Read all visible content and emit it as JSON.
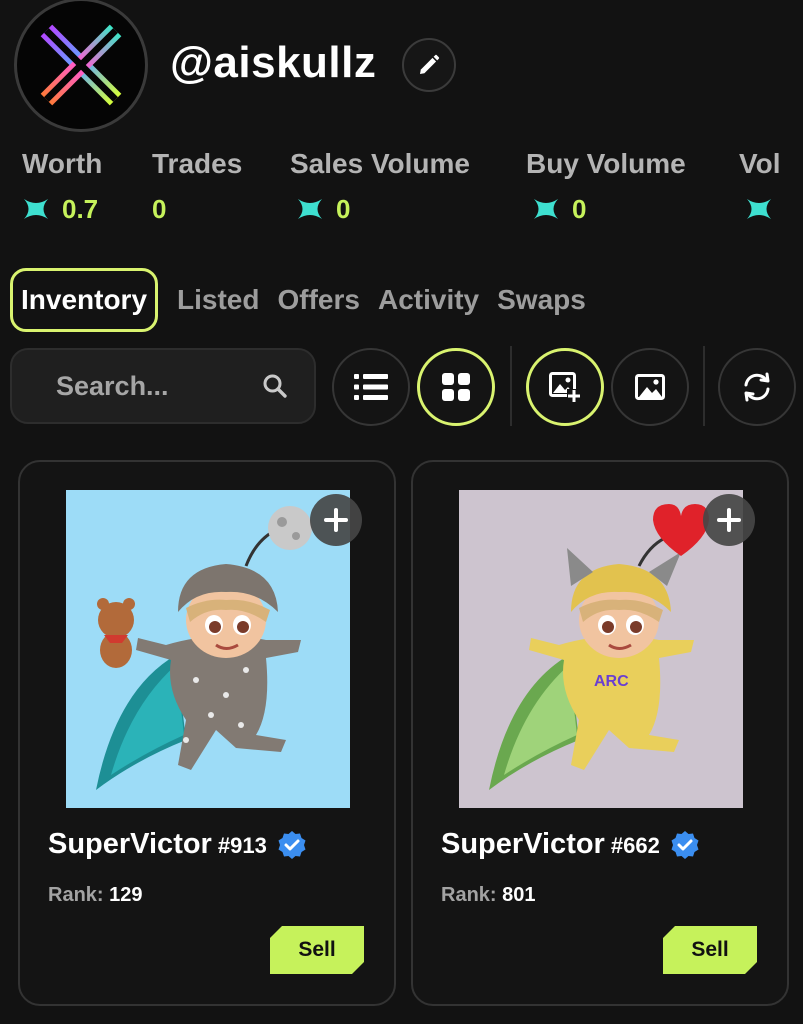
{
  "profile": {
    "username": "@aiskullz",
    "avatar_icon": "x-logo-icon",
    "edit_icon": "pencil-icon"
  },
  "stats": [
    {
      "label": "Worth",
      "value": "0.7",
      "currency_icon": "x-token-icon"
    },
    {
      "label": "Trades",
      "value": "0"
    },
    {
      "label": "Sales Volume",
      "value": "0",
      "currency_icon": "x-token-icon"
    },
    {
      "label": "Buy Volume",
      "value": "0",
      "currency_icon": "x-token-icon"
    },
    {
      "label": "Vol",
      "value": "",
      "currency_icon": "x-token-icon"
    }
  ],
  "tabs": [
    {
      "label": "Inventory",
      "active": true
    },
    {
      "label": "Listed"
    },
    {
      "label": "Offers"
    },
    {
      "label": "Activity"
    },
    {
      "label": "Swaps"
    }
  ],
  "toolbar": {
    "search_placeholder": "Search...",
    "buttons": [
      {
        "icon": "list-view-icon"
      },
      {
        "icon": "grid-view-icon",
        "active": true
      },
      {
        "icon": "image-add-icon",
        "active": true
      },
      {
        "icon": "image-icon"
      },
      {
        "icon": "refresh-icon"
      }
    ]
  },
  "cards": [
    {
      "name": "SuperVictor",
      "number": "#913",
      "rank_label": "Rank:",
      "rank": "129",
      "sell_label": "Sell",
      "background": "#9ddcf7",
      "outfit": "#837a73",
      "accessory": "moon"
    },
    {
      "name": "SuperVictor",
      "number": "#662",
      "rank_label": "Rank:",
      "rank": "801",
      "sell_label": "Sell",
      "background": "#cdc4cf",
      "outfit": "#e9cf5b",
      "accessory": "heart",
      "shirt_text": "ARC"
    }
  ],
  "colors": {
    "accent": "#c6f25b",
    "active_border": "#d9f36f",
    "background": "#121212",
    "verified": "#3b8ef0"
  }
}
